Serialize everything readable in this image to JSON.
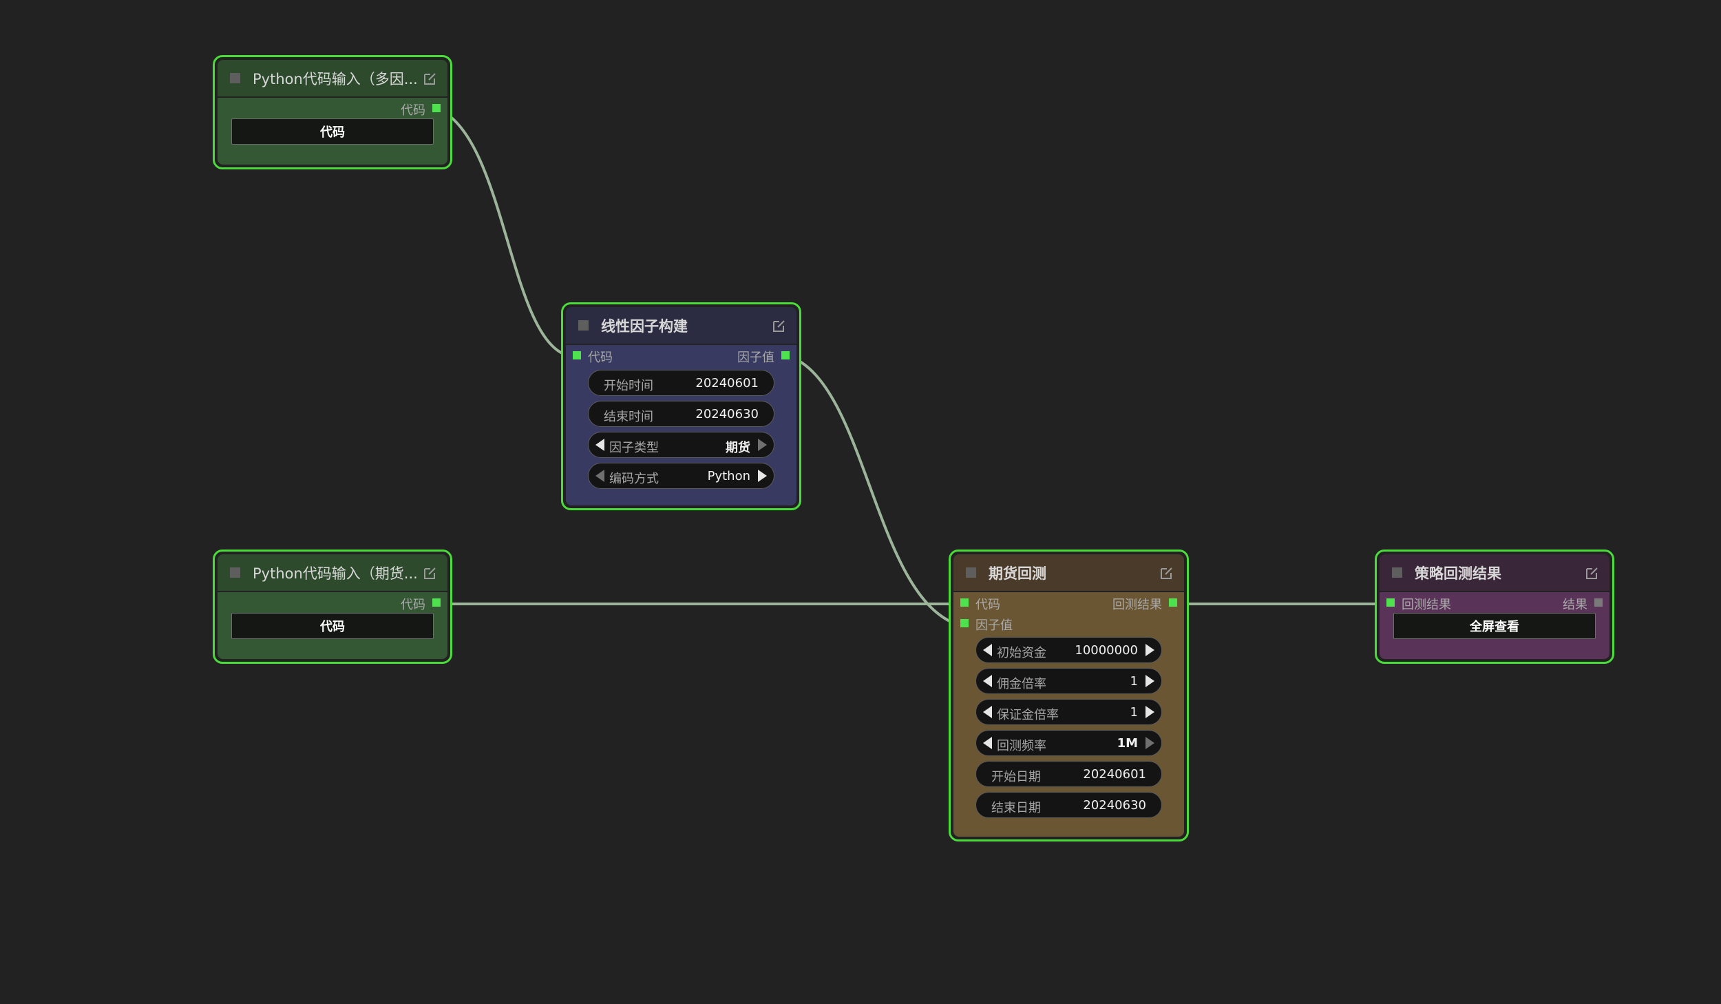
{
  "colors": {
    "background": "#222222",
    "node_border_selected": "#4bdc3c",
    "slot_connected": "#4ee24e",
    "link": "#9cb49a"
  },
  "nodes": {
    "py_input_1": {
      "title": "Python代码输入（多因...",
      "output_label": "代码",
      "button_label": "代码"
    },
    "linear_factor": {
      "title": "线性因子构建",
      "input_label": "代码",
      "output_label": "因子值",
      "widgets": [
        {
          "label": "开始时间",
          "value": "20240601"
        },
        {
          "label": "结束时间",
          "value": "20240630"
        },
        {
          "label": "因子类型",
          "value": "期货"
        },
        {
          "label": "编码方式",
          "value": "Python"
        }
      ]
    },
    "py_input_2": {
      "title": "Python代码输入（期货...",
      "output_label": "代码",
      "button_label": "代码"
    },
    "futures_backtest": {
      "title": "期货回测",
      "input_labels": [
        "代码",
        "因子值"
      ],
      "output_label": "回测结果",
      "widgets": [
        {
          "label": "初始资金",
          "value": "10000000"
        },
        {
          "label": "佣金倍率",
          "value": "1"
        },
        {
          "label": "保证金倍率",
          "value": "1"
        },
        {
          "label": "回测频率",
          "value": "1M"
        },
        {
          "label": "开始日期",
          "value": "20240601"
        },
        {
          "label": "结束日期",
          "value": "20240630"
        }
      ]
    },
    "strategy_result": {
      "title": "策略回测结果",
      "input_label": "回测结果",
      "output_label": "结果",
      "button_label": "全屏查看"
    }
  }
}
